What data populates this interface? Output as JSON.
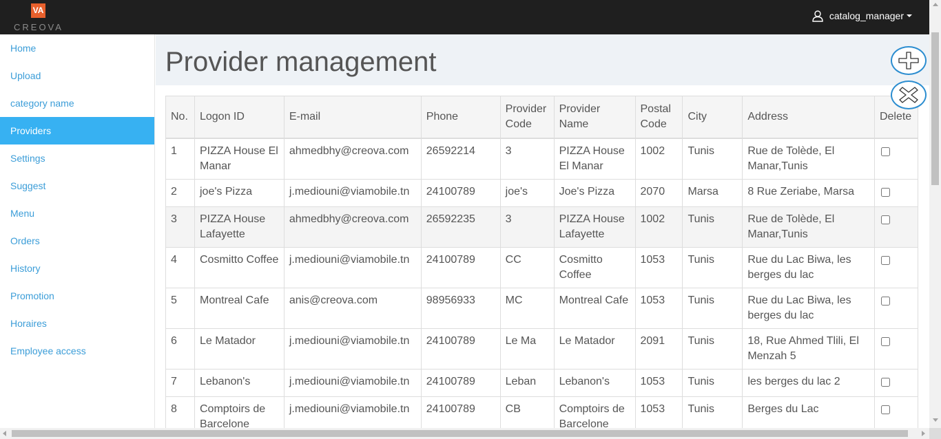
{
  "brand": {
    "logo_mark": "VA",
    "logo_text": "CREOVA",
    "accent": "#e8602c"
  },
  "user_menu": {
    "username": "catalog_manager",
    "icon": "user-icon"
  },
  "sidebar": {
    "active_color": "#37b1f2",
    "items": [
      {
        "label": "Home"
      },
      {
        "label": "Upload"
      },
      {
        "label": "category name"
      },
      {
        "label": "Providers",
        "active": true
      },
      {
        "label": "Settings"
      },
      {
        "label": "Suggest"
      },
      {
        "label": "Menu"
      },
      {
        "label": "Orders"
      },
      {
        "label": "History"
      },
      {
        "label": "Promotion"
      },
      {
        "label": "Horaires"
      },
      {
        "label": "Employee access"
      }
    ]
  },
  "page": {
    "title": "Provider management"
  },
  "actions": {
    "add_icon": "plus-icon",
    "close_icon": "close-icon"
  },
  "table": {
    "headers": [
      "No.",
      "Logon ID",
      "E-mail",
      "Phone",
      "Provider Code",
      "Provider Name",
      "Postal Code",
      "City",
      "Address",
      "Delete"
    ],
    "rows": [
      [
        "1",
        "PIZZA House El Manar",
        "ahmedbhy@creova.com",
        "26592214",
        "3",
        "PIZZA House El Manar",
        "1002",
        "Tunis",
        "Rue de Tolède, El Manar,Tunis"
      ],
      [
        "2",
        "joe's Pizza",
        "j.mediouni@viamobile.tn",
        "24100789",
        "joe's",
        "Joe's Pizza",
        "2070",
        "Marsa",
        "8 Rue Zeriabe, Marsa"
      ],
      [
        "3",
        "PIZZA House Lafayette",
        "ahmedbhy@creova.com",
        "26592235",
        "3",
        "PIZZA House Lafayette",
        "1002",
        "Tunis",
        "Rue de Tolède, El Manar,Tunis"
      ],
      [
        "4",
        "Cosmitto Coffee",
        "j.mediouni@viamobile.tn",
        "24100789",
        "CC",
        "Cosmitto Coffee",
        "1053",
        "Tunis",
        "Rue du Lac Biwa, les berges du lac"
      ],
      [
        "5",
        "Montreal Cafe",
        "anis@creova.com",
        "98956933",
        "MC",
        "Montreal Cafe",
        "1053",
        "Tunis",
        "Rue du Lac Biwa, les berges du lac"
      ],
      [
        "6",
        "Le Matador",
        "j.mediouni@viamobile.tn",
        "24100789",
        "Le Ma",
        "Le Matador",
        "2091",
        "Tunis",
        "18, Rue Ahmed Tlili, El Menzah 5"
      ],
      [
        "7",
        "Lebanon's",
        "j.mediouni@viamobile.tn",
        "24100789",
        "Leban",
        "Lebanon's",
        "1053",
        "Tunis",
        "les berges du lac 2"
      ],
      [
        "8",
        "Comptoirs de Barcelone",
        "j.mediouni@viamobile.tn",
        "24100789",
        "CB",
        "Comptoirs de Barcelone",
        "1053",
        "Tunis",
        "Berges du Lac"
      ]
    ]
  }
}
